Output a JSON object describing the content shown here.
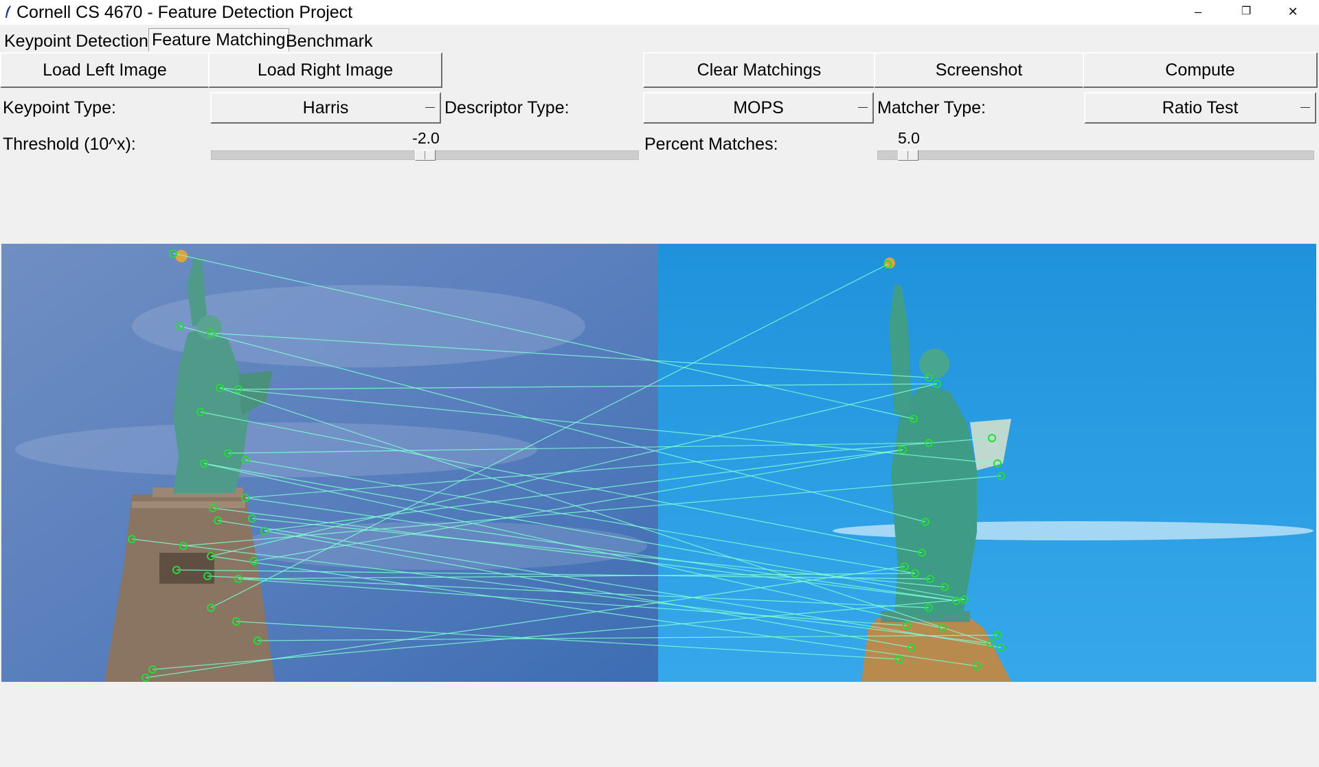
{
  "window": {
    "title": "Cornell CS 4670 - Feature Detection Project",
    "controls": {
      "minimize": "–",
      "maximize": "❐",
      "close": "✕"
    }
  },
  "tabs": [
    {
      "label": "Keypoint Detection",
      "active": false
    },
    {
      "label": "Feature Matching",
      "active": true
    },
    {
      "label": "Benchmark",
      "active": false
    }
  ],
  "toolbar": {
    "load_left": "Load Left Image",
    "load_right": "Load Right Image",
    "clear_matchings": "Clear Matchings",
    "screenshot": "Screenshot",
    "compute": "Compute"
  },
  "options": {
    "keypoint_type_label": "Keypoint Type:",
    "keypoint_type_value": "Harris",
    "descriptor_type_label": "Descriptor Type:",
    "descriptor_type_value": "MOPS",
    "matcher_type_label": "Matcher Type:",
    "matcher_type_value": "Ratio Test"
  },
  "sliders": {
    "threshold_label": "Threshold (10^x):",
    "threshold_value": "-2.0",
    "threshold_fraction": 0.5,
    "percent_label": "Percent Matches:",
    "percent_value": "5.0",
    "percent_fraction": 0.07
  },
  "colors": {
    "left_sky": "#5b82bd",
    "right_sky": "#1e9be0",
    "statue": "#4f9a88",
    "pedestal": "#8a7563",
    "match_line": "#7fffd4",
    "keypoint": "#22dd33"
  }
}
